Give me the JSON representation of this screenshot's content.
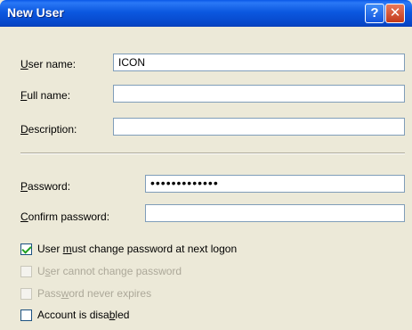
{
  "window": {
    "title": "New User",
    "help_label": "?",
    "close_label": "✕"
  },
  "form": {
    "user_name": {
      "label_pre": "",
      "label_key": "U",
      "label_post": "ser name:",
      "value": "ICON"
    },
    "full_name": {
      "label_pre": "",
      "label_key": "F",
      "label_post": "ull name:",
      "value": ""
    },
    "description": {
      "label_pre": "",
      "label_key": "D",
      "label_post": "escription:",
      "value": ""
    },
    "password": {
      "label_pre": "",
      "label_key": "P",
      "label_post": "assword:",
      "value": "•••••••••••••"
    },
    "confirm_password": {
      "label_pre": "",
      "label_key": "C",
      "label_post": "onfirm password:",
      "value": ""
    }
  },
  "options": [
    {
      "pre": "User ",
      "key": "m",
      "post": "ust change password at next logon",
      "checked": true,
      "enabled": true
    },
    {
      "pre": "U",
      "key": "s",
      "post": "er cannot change password",
      "checked": false,
      "enabled": false
    },
    {
      "pre": "Pass",
      "key": "w",
      "post": "ord never expires",
      "checked": false,
      "enabled": false
    },
    {
      "pre": "Account is disa",
      "key": "b",
      "post": "led",
      "checked": false,
      "enabled": true
    }
  ]
}
